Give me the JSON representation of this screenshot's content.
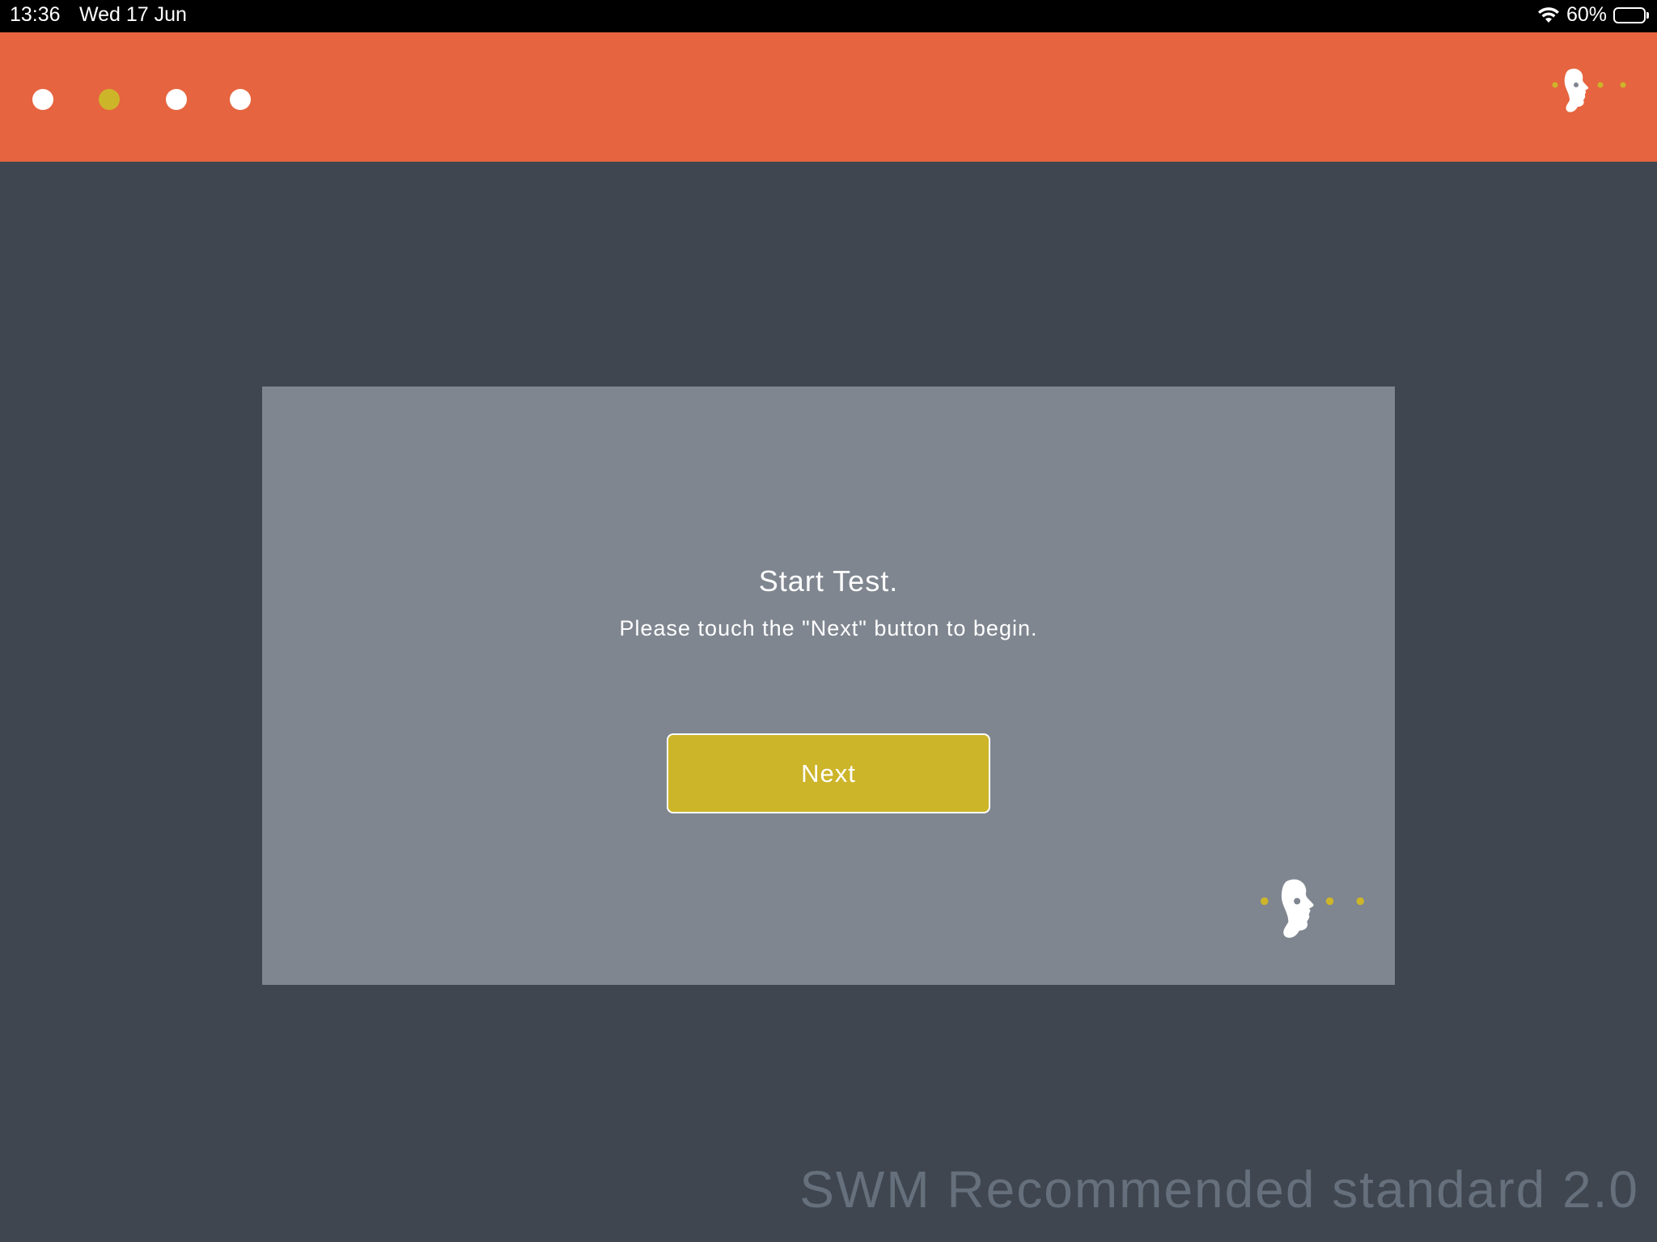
{
  "status_bar": {
    "time": "13:36",
    "date": "Wed 17 Jun",
    "battery_percent_label": "60%",
    "battery_level": 0.6,
    "wifi_icon": "wifi-icon",
    "battery_icon": "battery-icon"
  },
  "header": {
    "steps": [
      {
        "state": "complete"
      },
      {
        "state": "current"
      },
      {
        "state": "upcoming"
      },
      {
        "state": "upcoming"
      }
    ],
    "logo_icon": "head-logo-icon"
  },
  "card": {
    "title": "Start Test.",
    "subtitle": "Please touch the \"Next\" button to begin.",
    "next_label": "Next",
    "logo_icon": "head-logo-icon"
  },
  "footer": {
    "test_name": "SWM Recommended standard 2.0"
  },
  "colors": {
    "accent_orange": "#e6643f",
    "accent_yellow": "#cdb52a",
    "background": "#3f4650",
    "card": "#7f8690",
    "footer_text": "#66707c"
  }
}
